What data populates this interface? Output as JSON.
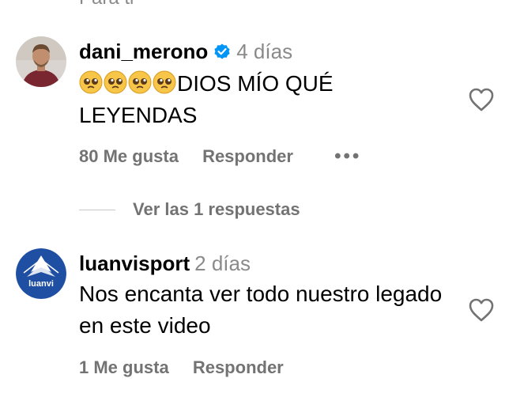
{
  "cut_off_text": "Para ti",
  "comments": [
    {
      "username": "dani_merono",
      "verified": true,
      "time": "4 días",
      "text": "DIOS MÍO QUÉ LEYENDAS",
      "emojis": [
        "pleading-face",
        "pleading-face",
        "pleading-face",
        "pleading-face"
      ],
      "likes": "80 Me gusta",
      "reply": "Responder",
      "more": "•••",
      "view_replies": "Ver las 1 respuestas"
    },
    {
      "username": "luanvisport",
      "verified": false,
      "time": "2 días",
      "text": "Nos encanta ver todo nuestro legado en este video",
      "avatar_text": "luanvi",
      "likes": "1 Me gusta",
      "reply": "Responder"
    }
  ],
  "colors": {
    "secondary_text": "#737373",
    "timestamp": "#8a8a8a",
    "verified_badge": "#0095f6",
    "luanvi_brand": "#1f4fa3"
  }
}
